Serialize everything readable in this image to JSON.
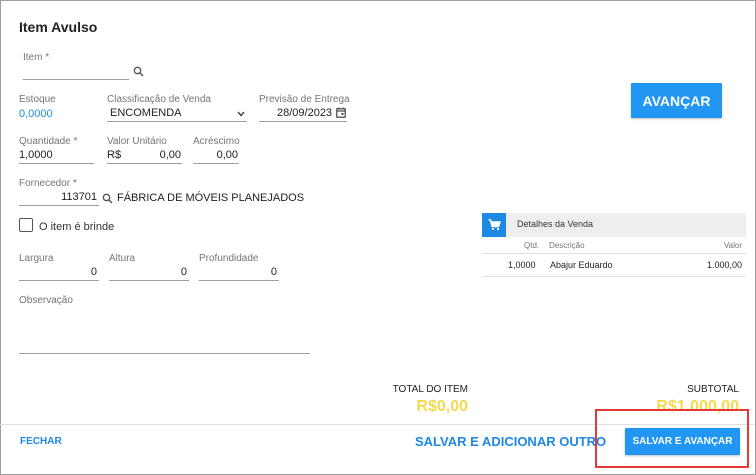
{
  "dialog": {
    "title": "Item Avulso"
  },
  "item": {
    "label": "Item *",
    "value": ""
  },
  "estoque": {
    "label": "Estoque",
    "value": "0,0000"
  },
  "classificacao": {
    "label": "Classificação de Venda",
    "value": "ENCOMENDA"
  },
  "previsao": {
    "label": "Previsão de Entrega",
    "value": "28/09/2023"
  },
  "quantidade": {
    "label": "Quantidade *",
    "value": "1,0000"
  },
  "valor_unitario": {
    "label": "Valor Unitário",
    "currency": "R$",
    "value": "0,00"
  },
  "acrescimo": {
    "label": "Acréscimo",
    "value": "0,00"
  },
  "fornecedor": {
    "label": "Fornecedor *",
    "code": "113701",
    "name": "FÁBRICA DE MÓVEIS PLANEJADOS"
  },
  "brinde": {
    "label": "O item é brinde",
    "checked": false
  },
  "largura": {
    "label": "Largura",
    "value": "0"
  },
  "altura": {
    "label": "Altura",
    "value": "0"
  },
  "profundidade": {
    "label": "Profundidade",
    "value": "0"
  },
  "observacao": {
    "label": "Observação",
    "value": ""
  },
  "avancar_label": "AVANÇAR",
  "detalhes": {
    "title": "Detalhes da Venda",
    "headers": {
      "qtd": "Qtd.",
      "descricao": "Descrição",
      "valor": "Valor"
    },
    "rows": [
      {
        "qtd": "1,0000",
        "descricao": "Abajur Eduardo",
        "valor": "1.000,00"
      }
    ]
  },
  "totals": {
    "total_item_label": "TOTAL DO ITEM",
    "total_item_value": "R$0,00",
    "subtotal_label": "SUBTOTAL",
    "subtotal_value": "R$1.000,00"
  },
  "footer": {
    "fechar": "FECHAR",
    "salvar_adicionar": "SALVAR E ADICIONAR OUTRO",
    "salvar_avancar": "SALVAR E AVANÇAR"
  },
  "colors": {
    "accent": "#2196f3",
    "total_value": "#f5d94e",
    "highlight_box": "#e53935"
  },
  "icons": {
    "search": "search-icon",
    "calendar": "calendar-icon",
    "dropdown": "chevron-down-icon",
    "cart": "cart-icon"
  }
}
